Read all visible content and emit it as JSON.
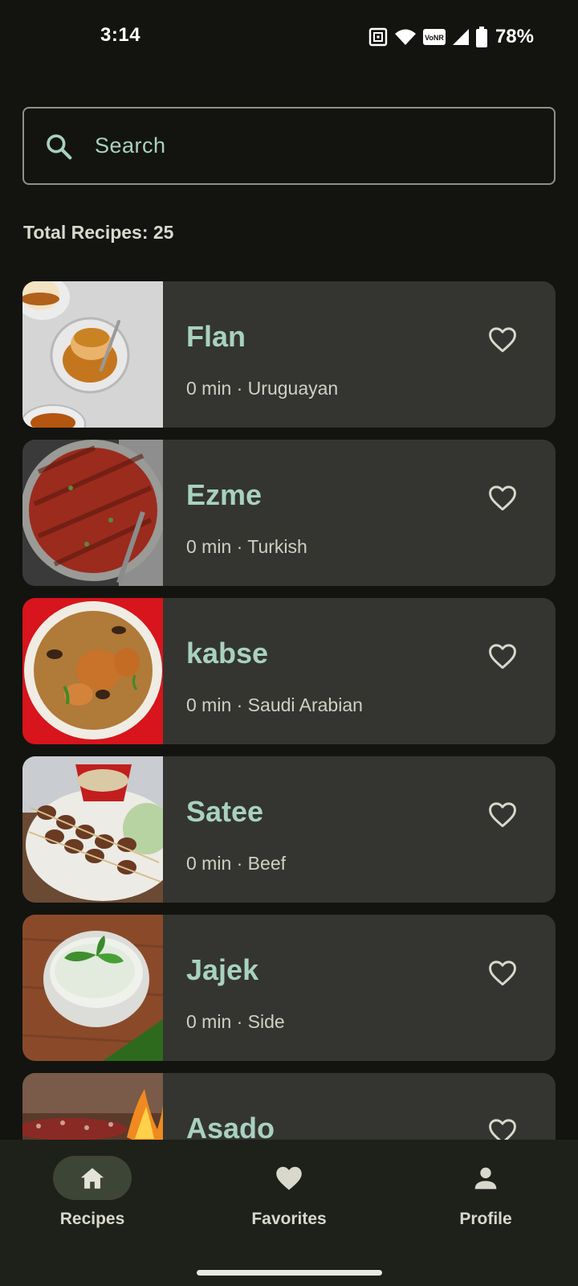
{
  "status_bar": {
    "time": "3:14",
    "battery_percent": "78%",
    "network_badge": "VoNR",
    "icons": [
      "nfc-icon",
      "wifi-icon",
      "vonr-icon",
      "signal-icon",
      "battery-icon"
    ]
  },
  "search": {
    "placeholder": "Search"
  },
  "summary": {
    "total_label": "Total Recipes: 25"
  },
  "recipes": [
    {
      "name": "Flan",
      "meta": "0 min · Uruguayan",
      "favorite": false
    },
    {
      "name": "Ezme",
      "meta": "0 min · Turkish",
      "favorite": false
    },
    {
      "name": "kabse",
      "meta": "0 min · Saudi Arabian",
      "favorite": false
    },
    {
      "name": "Satee",
      "meta": "0 min · Beef",
      "favorite": false
    },
    {
      "name": "Jajek",
      "meta": "0 min · Side",
      "favorite": false
    },
    {
      "name": "Asado",
      "meta": "",
      "favorite": false
    }
  ],
  "bottom_nav": {
    "items": [
      {
        "label": "Recipes",
        "icon": "home-icon",
        "active": true
      },
      {
        "label": "Favorites",
        "icon": "heart-icon",
        "active": false
      },
      {
        "label": "Profile",
        "icon": "person-icon",
        "active": false
      }
    ]
  },
  "colors": {
    "background": "#131410",
    "card": "#343530",
    "accent": "#a8d1c2",
    "nav_background": "#1e201a",
    "nav_active_pill": "#3d4536"
  }
}
